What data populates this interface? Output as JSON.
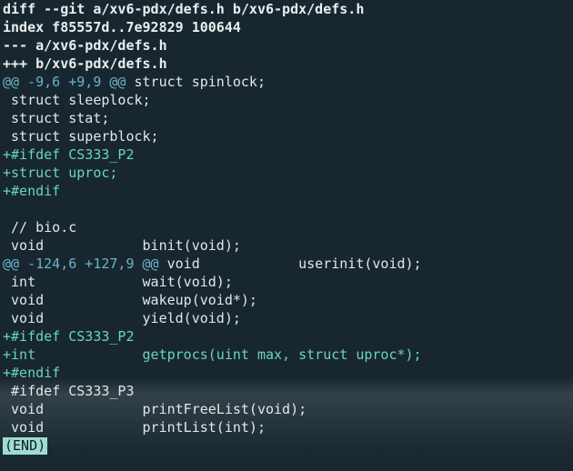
{
  "header": {
    "diff_line": "diff --git a/xv6-pdx/defs.h b/xv6-pdx/defs.h",
    "index_line": "index f85557d..7e92829 100644",
    "old_file": "--- a/xv6-pdx/defs.h",
    "new_file": "+++ b/xv6-pdx/defs.h"
  },
  "hunk1": {
    "range": "@@ -9,6 +9,9 @@",
    "context": " struct spinlock;",
    "lines": [
      {
        "kind": "ctx",
        "text": " struct sleeplock;"
      },
      {
        "kind": "ctx",
        "text": " struct stat;"
      },
      {
        "kind": "ctx",
        "text": " struct superblock;"
      },
      {
        "kind": "add",
        "text": "+#ifdef CS333_P2"
      },
      {
        "kind": "add",
        "text": "+struct uproc;"
      },
      {
        "kind": "add",
        "text": "+#endif"
      },
      {
        "kind": "ctx",
        "text": ""
      },
      {
        "kind": "ctx",
        "text": " // bio.c"
      },
      {
        "kind": "ctx",
        "text": " void            binit(void);"
      }
    ]
  },
  "hunk2": {
    "range": "@@ -124,6 +127,9 @@",
    "context": " void            userinit(void);",
    "lines": [
      {
        "kind": "ctx",
        "text": " int             wait(void);"
      },
      {
        "kind": "ctx",
        "text": " void            wakeup(void*);"
      },
      {
        "kind": "ctx",
        "text": " void            yield(void);"
      },
      {
        "kind": "add",
        "text": "+#ifdef CS333_P2"
      },
      {
        "kind": "add",
        "text": "+int             getprocs(uint max, struct uproc*);"
      },
      {
        "kind": "add",
        "text": "+#endif"
      },
      {
        "kind": "ctx",
        "text": " #ifdef CS333_P3"
      },
      {
        "kind": "ctx",
        "text": " void            printFreeList(void);"
      },
      {
        "kind": "ctx",
        "text": " void            printList(int);"
      }
    ]
  },
  "pager": {
    "status": "(END)"
  },
  "colors": {
    "background": "#18272f",
    "added": "#67d7b4",
    "hunk_marker": "#6ab3cc",
    "context": "#dfe7ea",
    "status_bg": "#9fdcd0"
  }
}
